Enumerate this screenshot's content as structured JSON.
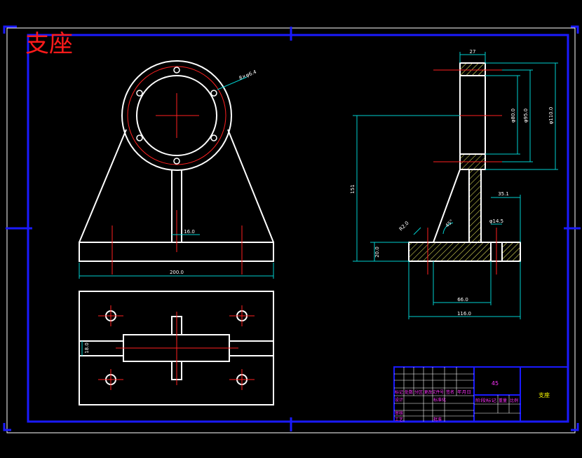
{
  "title": "支座",
  "colors": {
    "background": "#000000",
    "frame": "#1a1aff",
    "outline": "#ffffff",
    "centerline": "#ff2020",
    "dimension": "#00d0d0",
    "hatch": "#ffff66",
    "titleblock_text": "#ff33ff",
    "title_text": "#ff1a1a"
  },
  "front_view": {
    "labels": {
      "bolt_circle": "8×φ6.4",
      "rib_width": "16.0",
      "overall_width": "200.0"
    }
  },
  "top_view": {
    "labels": {
      "slot_width": "18.0"
    }
  },
  "side_view": {
    "labels": {
      "top_width": "27",
      "bore_dia": "φ80.0",
      "bolt_circle_dia": "φ95.0",
      "outer_dia": "φ110.0",
      "total_height": "151",
      "base_thickness": "20.0",
      "chamfer": "R2.0",
      "rib_angle": "45°",
      "hole_offset": "35.1",
      "hole_dia": "φ14.5",
      "base_mid": "66.0",
      "base_length": "116.0"
    }
  },
  "title_block": {
    "material": "45",
    "part_name": "支座",
    "cells": [
      "标记",
      "处数",
      "分区",
      "更改文件号",
      "签名",
      "年月日",
      "设计",
      "标准化",
      "审核",
      "工艺",
      "批准",
      "阶段标记",
      "重量",
      "比例"
    ]
  }
}
